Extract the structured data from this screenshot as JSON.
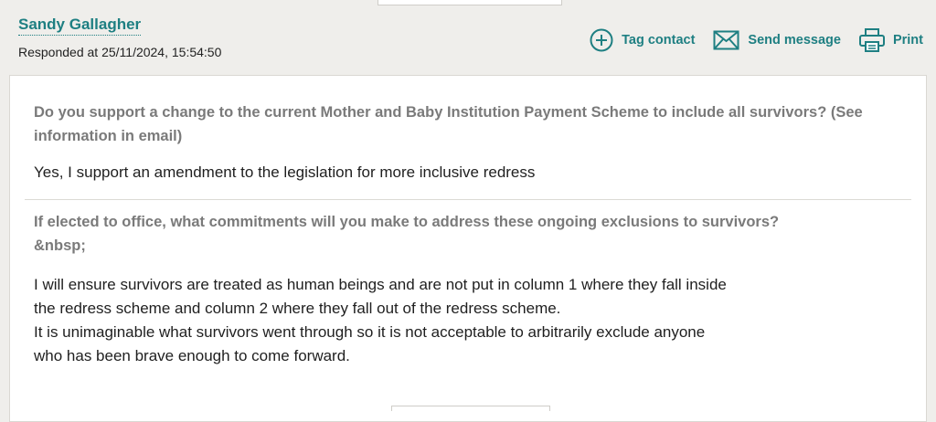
{
  "respondent": {
    "name": "Sandy Gallagher",
    "responded_at": "Responded at 25/11/2024, 15:54:50"
  },
  "actions": {
    "tag_contact": "Tag contact",
    "send_message": "Send message",
    "print": "Print"
  },
  "questions": [
    {
      "question": "Do you support a change to the current Mother and Baby Institution Payment Scheme to include all survivors? (See information in email)",
      "answer_lines": [
        "Yes, I support an amendment to the legislation for more inclusive redress"
      ]
    },
    {
      "question_lines": [
        "If elected to office, what commitments will you make to address these ongoing exclusions to survivors?",
        "&nbsp;"
      ],
      "answer_lines": [
        "I will ensure survivors are treated as human beings and are not put in column 1 where they fall inside",
        "the redress scheme and column 2 where they fall out of the redress scheme.",
        "It is unimaginable what survivors went through so it is not acceptable to arbitrarily exclude anyone",
        "who has been brave enough to come forward."
      ]
    }
  ],
  "colors": {
    "accent": "#1e7f82",
    "question_text": "#7a7a7a",
    "background": "#efeeeb"
  }
}
